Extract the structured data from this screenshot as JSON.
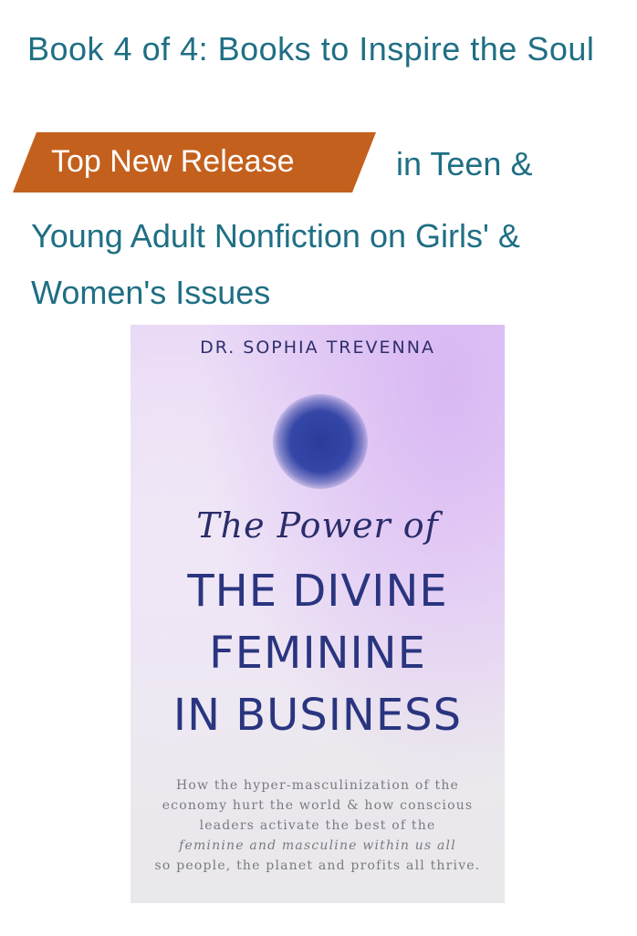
{
  "series": {
    "label": "Book 4 of 4: Books to Inspire the Soul"
  },
  "badge": {
    "label": "Top New Release",
    "color": "#c4601d",
    "suffix": "in Teen &",
    "category": "Young Adult Nonfiction on Girls' & Women's Issues"
  },
  "cover": {
    "author": "DR. SOPHIA TREVENNA",
    "script_title": "The Power of",
    "title_lines": [
      "THE DIVINE",
      "FEMININE",
      "IN BUSINESS"
    ],
    "blurb_lines": [
      "How the hyper-masculinization of the",
      "economy hurt the world & how conscious",
      "leaders activate the best of the",
      "feminine and masculine within us all",
      "so people, the planet and profits all thrive."
    ],
    "orb_color": "#3446a6",
    "title_color": "#2a3580"
  },
  "colors": {
    "link": "#1f6f84",
    "badge_text": "#ffffff"
  }
}
